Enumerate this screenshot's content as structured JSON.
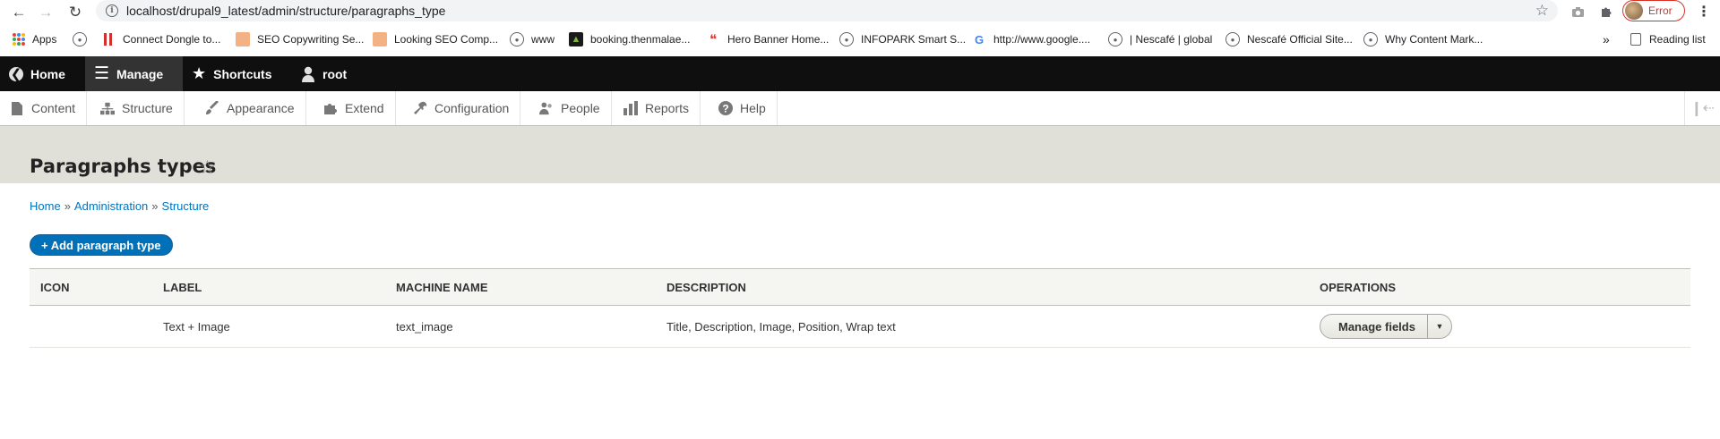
{
  "browser": {
    "url": "localhost/drupal9_latest/admin/structure/paragraphs_type",
    "profile_status": "Error"
  },
  "bookmarks": [
    {
      "label": "Apps",
      "icon": "apps-grid-icon"
    },
    {
      "label": "",
      "icon": "globe-icon"
    },
    {
      "label": "Connect Dongle to...",
      "icon": "red-bars-icon"
    },
    {
      "label": "SEO Copywriting Se...",
      "icon": "site-favicon"
    },
    {
      "label": "Looking SEO Comp...",
      "icon": "site-favicon"
    },
    {
      "label": "www",
      "icon": "globe-icon"
    },
    {
      "label": "booking.thenmalae...",
      "icon": "site-favicon"
    },
    {
      "label": "Hero Banner Home...",
      "icon": "red-swoosh-icon"
    },
    {
      "label": "INFOPARK Smart S...",
      "icon": "globe-icon"
    },
    {
      "label": "http://www.google....",
      "icon": "google-icon"
    },
    {
      "label": "| Nescafé | global",
      "icon": "globe-icon"
    },
    {
      "label": "Nescafé Official Site...",
      "icon": "globe-icon"
    },
    {
      "label": "Why Content Mark...",
      "icon": "globe-icon"
    }
  ],
  "bookmarks_overflow": "»",
  "reading_list": "Reading list",
  "toolbar": {
    "home": "Home",
    "manage": "Manage",
    "shortcuts": "Shortcuts",
    "user": "root"
  },
  "tray": {
    "content": "Content",
    "structure": "Structure",
    "appearance": "Appearance",
    "extend": "Extend",
    "configuration": "Configuration",
    "people": "People",
    "reports": "Reports",
    "help": "Help"
  },
  "page": {
    "title": "Paragraphs types",
    "breadcrumb": [
      "Home",
      "Administration",
      "Structure"
    ],
    "breadcrumb_sep": "»",
    "add_button": "+ Add paragraph type"
  },
  "table": {
    "headers": [
      "ICON",
      "LABEL",
      "MACHINE NAME",
      "DESCRIPTION",
      "OPERATIONS"
    ],
    "rows": [
      {
        "icon": "",
        "label": "Text + Image",
        "machine_name": "text_image",
        "description": "Title, Description, Image, Position, Wrap text",
        "operation": "Manage fields"
      }
    ]
  },
  "colors": {
    "toolbar_bg": "#0f0f0f",
    "header_bg": "#e0e0d8",
    "link": "#0074bd",
    "primary_button": "#0071b8"
  }
}
